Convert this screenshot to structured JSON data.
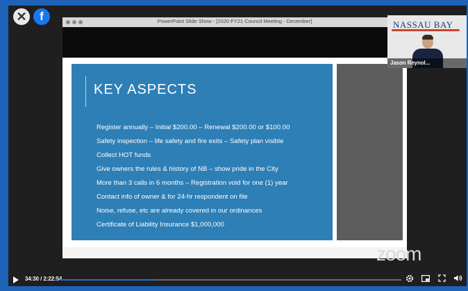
{
  "window": {
    "close_glyph": "✕",
    "facebook_glyph": "f"
  },
  "ppt": {
    "title": "PowerPoint Slide Show - [2020 FY21 Council Meeting - December]"
  },
  "slide": {
    "title": "KEY ASPECTS",
    "bullets": [
      "Register annually – Initial $200.00 – Renewal $200.00 or $100.00",
      "Safety inspection – life safety and fire exits – Safety plan visible",
      "Collect HOT funds",
      "Give owners the rules & history of NB – show pride in the City",
      "More than 3 calls in 6 months – Registration void for one (1) year",
      "Contact info of owner & for 24-hr respondent on file",
      "Noise, refuse, etc are already covered in our ordinances",
      "Certificate of Liability Insurance $1,000,000"
    ]
  },
  "participant": {
    "logo_text": "NASSAU BAY",
    "name": "Jason Reynol..."
  },
  "watermark": "zoom",
  "player": {
    "time": "34:30 / 2:22:54",
    "progress": 0.274
  },
  "colors": {
    "frame_blue": "#1d63b8",
    "slide_blue": "#2d7fb6",
    "progress_blue": "#1f6dd6"
  }
}
